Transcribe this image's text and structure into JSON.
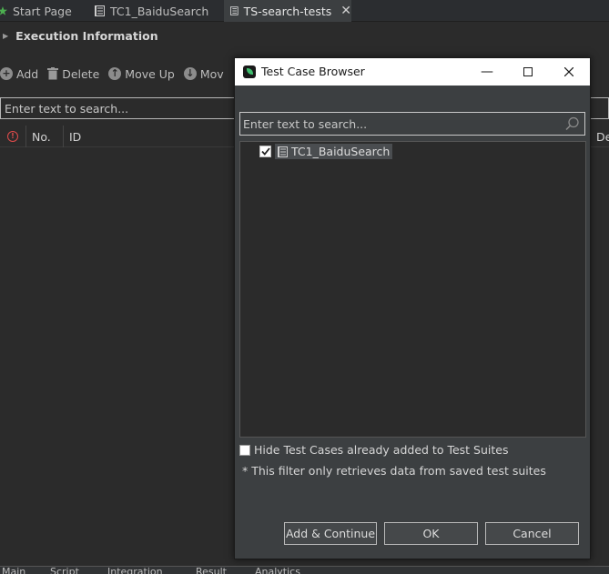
{
  "tabs": [
    {
      "label": "Start Page",
      "icon": "star-icon"
    },
    {
      "label": "TC1_BaiduSearch",
      "icon": "test-case-icon"
    },
    {
      "label": "TS-search-tests",
      "icon": "test-suite-icon",
      "active": true
    }
  ],
  "section": {
    "title": "Execution Information"
  },
  "toolbar": {
    "add_label": "Add",
    "delete_label": "Delete",
    "move_up_label": "Move Up",
    "move_down_label": "Mov"
  },
  "main_search": {
    "placeholder": "Enter text to search..."
  },
  "table": {
    "columns": [
      "No.",
      "ID"
    ],
    "right_column_partial": "De"
  },
  "bottom_tabs": [
    "Main",
    "Script",
    "Integration",
    "Result",
    "Analytics"
  ],
  "dialog": {
    "title": "Test Case Browser",
    "search_placeholder": "Enter text to search...",
    "tree_items": [
      {
        "label": "TC1_BaiduSearch",
        "checked": true
      }
    ],
    "hide_label": "Hide Test Cases already added to Test Suites",
    "note": "* This filter only retrieves data from saved test suites",
    "buttons": {
      "add_continue": "Add & Continue",
      "ok": "OK",
      "cancel": "Cancel"
    }
  },
  "colors": {
    "background": "#2b2b2b",
    "dialog_background": "#3c3f41",
    "titlebar": "#ffffff",
    "accent_green": "#3fbf6f",
    "error_red": "#e04b4b"
  }
}
